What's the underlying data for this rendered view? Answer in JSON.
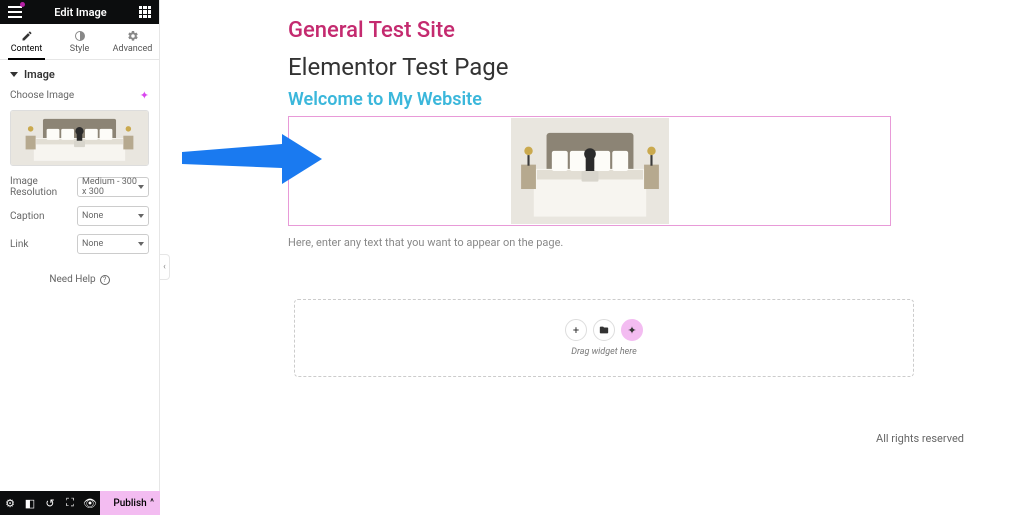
{
  "header": {
    "title": "Edit Image"
  },
  "tabs": {
    "content": "Content",
    "style": "Style",
    "advanced": "Advanced"
  },
  "section": {
    "title": "Image"
  },
  "fields": {
    "choose_image_label": "Choose Image",
    "resolution_label": "Image Resolution",
    "resolution_value": "Medium - 300 x 300",
    "caption_label": "Caption",
    "caption_value": "None",
    "link_label": "Link",
    "link_value": "None"
  },
  "help_label": "Need Help",
  "publish_label": "Publish",
  "canvas": {
    "site_title": "General Test Site",
    "page_title": "Elementor Test Page",
    "welcome": "Welcome to My Website",
    "placeholder_text": "Here, enter any text that you want to appear on the page.",
    "dropzone_hint": "Drag widget here",
    "footer": "All rights reserved"
  },
  "colors": {
    "accent_pink": "#f3bcf1",
    "brand_magenta": "#c42a6f",
    "highlight_cyan": "#3bb7db"
  }
}
